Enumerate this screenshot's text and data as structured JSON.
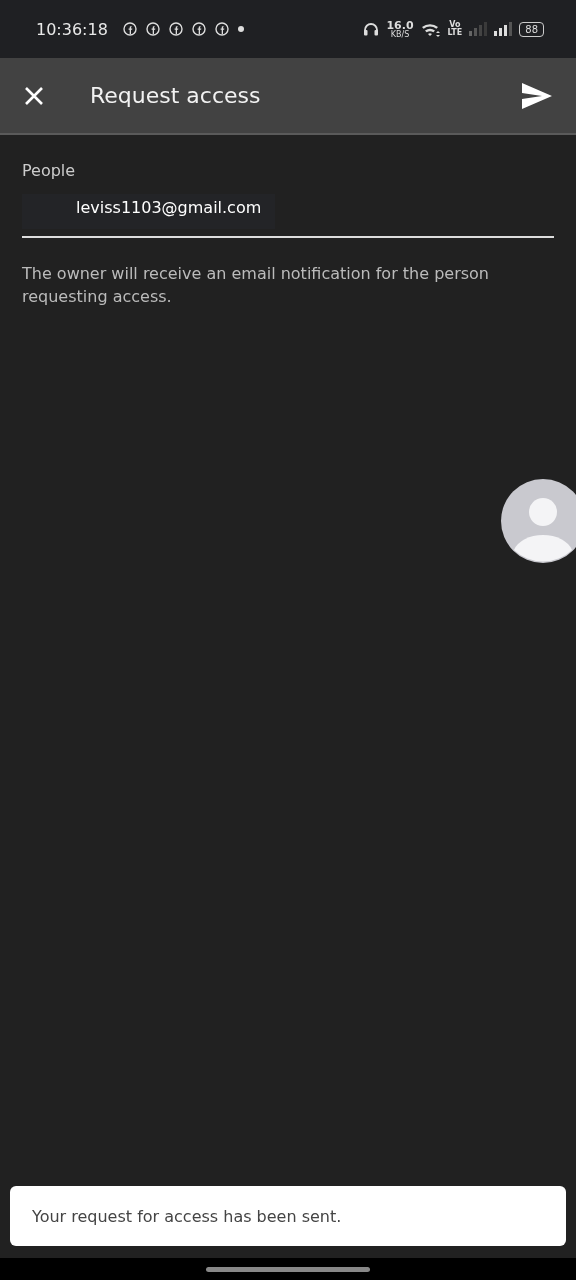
{
  "status_bar": {
    "time": "10:36:18",
    "notifications": [
      {
        "kind": "facebook"
      },
      {
        "kind": "facebook"
      },
      {
        "kind": "facebook"
      },
      {
        "kind": "facebook"
      },
      {
        "kind": "facebook"
      },
      {
        "kind": "dot"
      }
    ],
    "speed": "16.0",
    "speed_unit": "KB/S",
    "volte": [
      "Vo",
      "LTE"
    ],
    "battery": "88"
  },
  "app_bar": {
    "title": "Request access"
  },
  "form": {
    "label": "People",
    "value": "leviss1103@gmail.com",
    "helper": "The owner will receive an email notification for the person requesting access."
  },
  "chat_head": {
    "kind": "avatar"
  },
  "snackbar": {
    "message": "Your request for access has been sent."
  }
}
